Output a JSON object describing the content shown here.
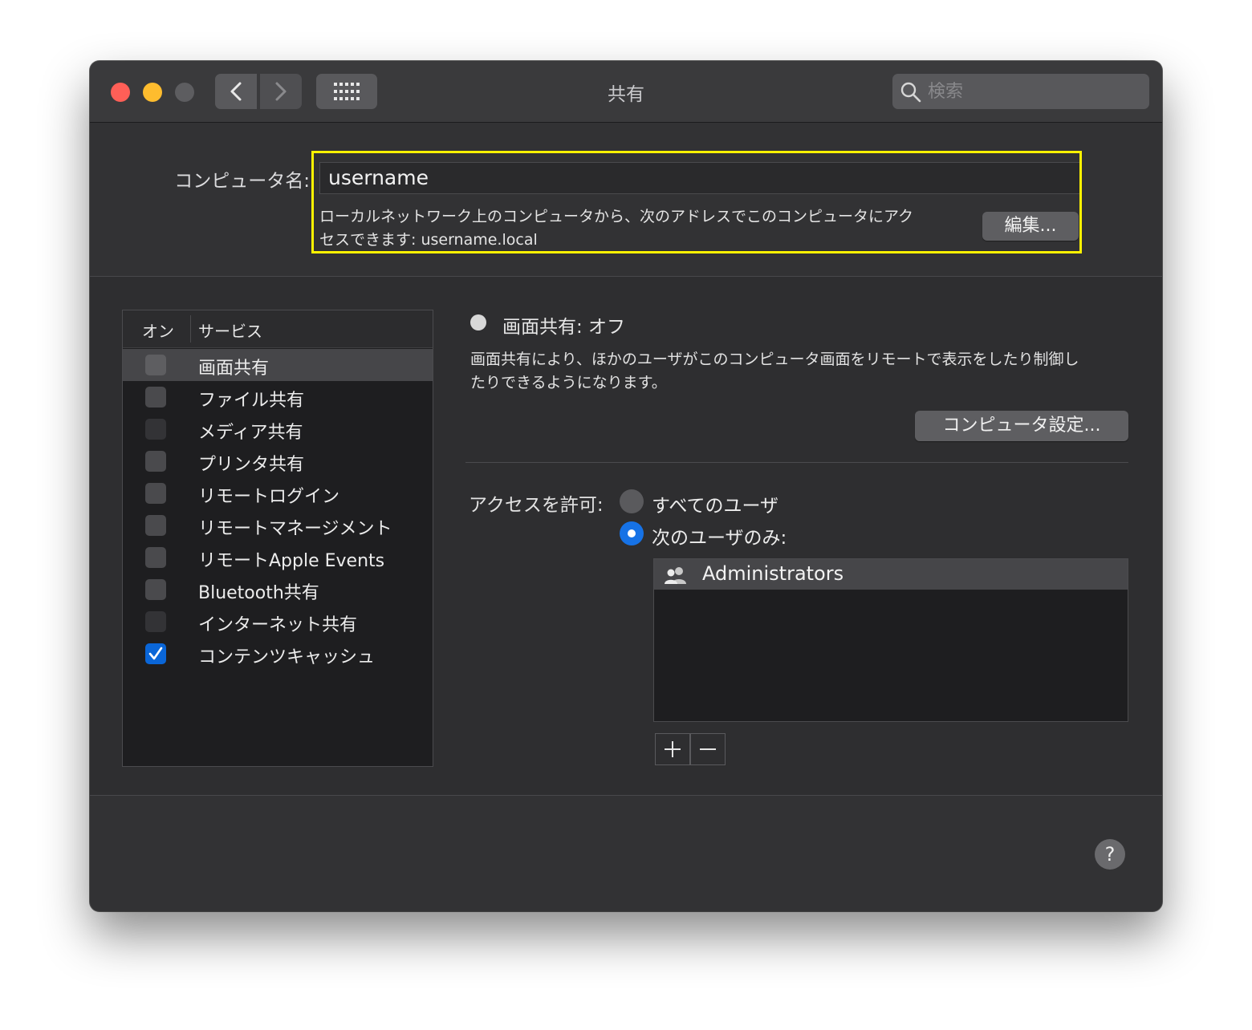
{
  "window": {
    "title": "共有"
  },
  "search": {
    "placeholder": "検索"
  },
  "computer_name": {
    "label": "コンピュータ名:",
    "value": "username",
    "description_line1": "ローカルネットワーク上のコンピュータから、次のアドレスでこのコンピュータにアク",
    "description_line2": "セスできます: username.local",
    "edit_label": "編集..."
  },
  "service_list": {
    "header_on": "オン",
    "header_service": "サービス",
    "items": [
      {
        "label": "画面共有",
        "checked": false,
        "selected": true
      },
      {
        "label": "ファイル共有",
        "checked": false
      },
      {
        "label": "メディア共有",
        "checked": false
      },
      {
        "label": "プリンタ共有",
        "checked": false
      },
      {
        "label": "リモートログイン",
        "checked": false
      },
      {
        "label": "リモートマネージメント",
        "checked": false
      },
      {
        "label": "リモートApple Events",
        "checked": false
      },
      {
        "label": "Bluetooth共有",
        "checked": false
      },
      {
        "label": "インターネット共有",
        "checked": false
      },
      {
        "label": "コンテンツキャッシュ",
        "checked": true
      }
    ]
  },
  "detail": {
    "status": "画面共有: オフ",
    "description_line1": "画面共有により、ほかのユーザがこのコンピュータ画面をリモートで表示をしたり制御し",
    "description_line2": "たりできるようになります。",
    "computer_settings_label": "コンピュータ設定...",
    "access_label": "アクセスを許可:",
    "radio_all": "すべてのユーザ",
    "radio_only": "次のユーザのみ:",
    "selected_radio": "only",
    "users": [
      "Administrators"
    ],
    "add_label": "+",
    "remove_label": "−"
  },
  "help": {
    "label": "?"
  },
  "colors": {
    "accent": "#1672e6",
    "highlight": "#fff200",
    "close": "#ff5f57",
    "minimize": "#febc2e"
  }
}
